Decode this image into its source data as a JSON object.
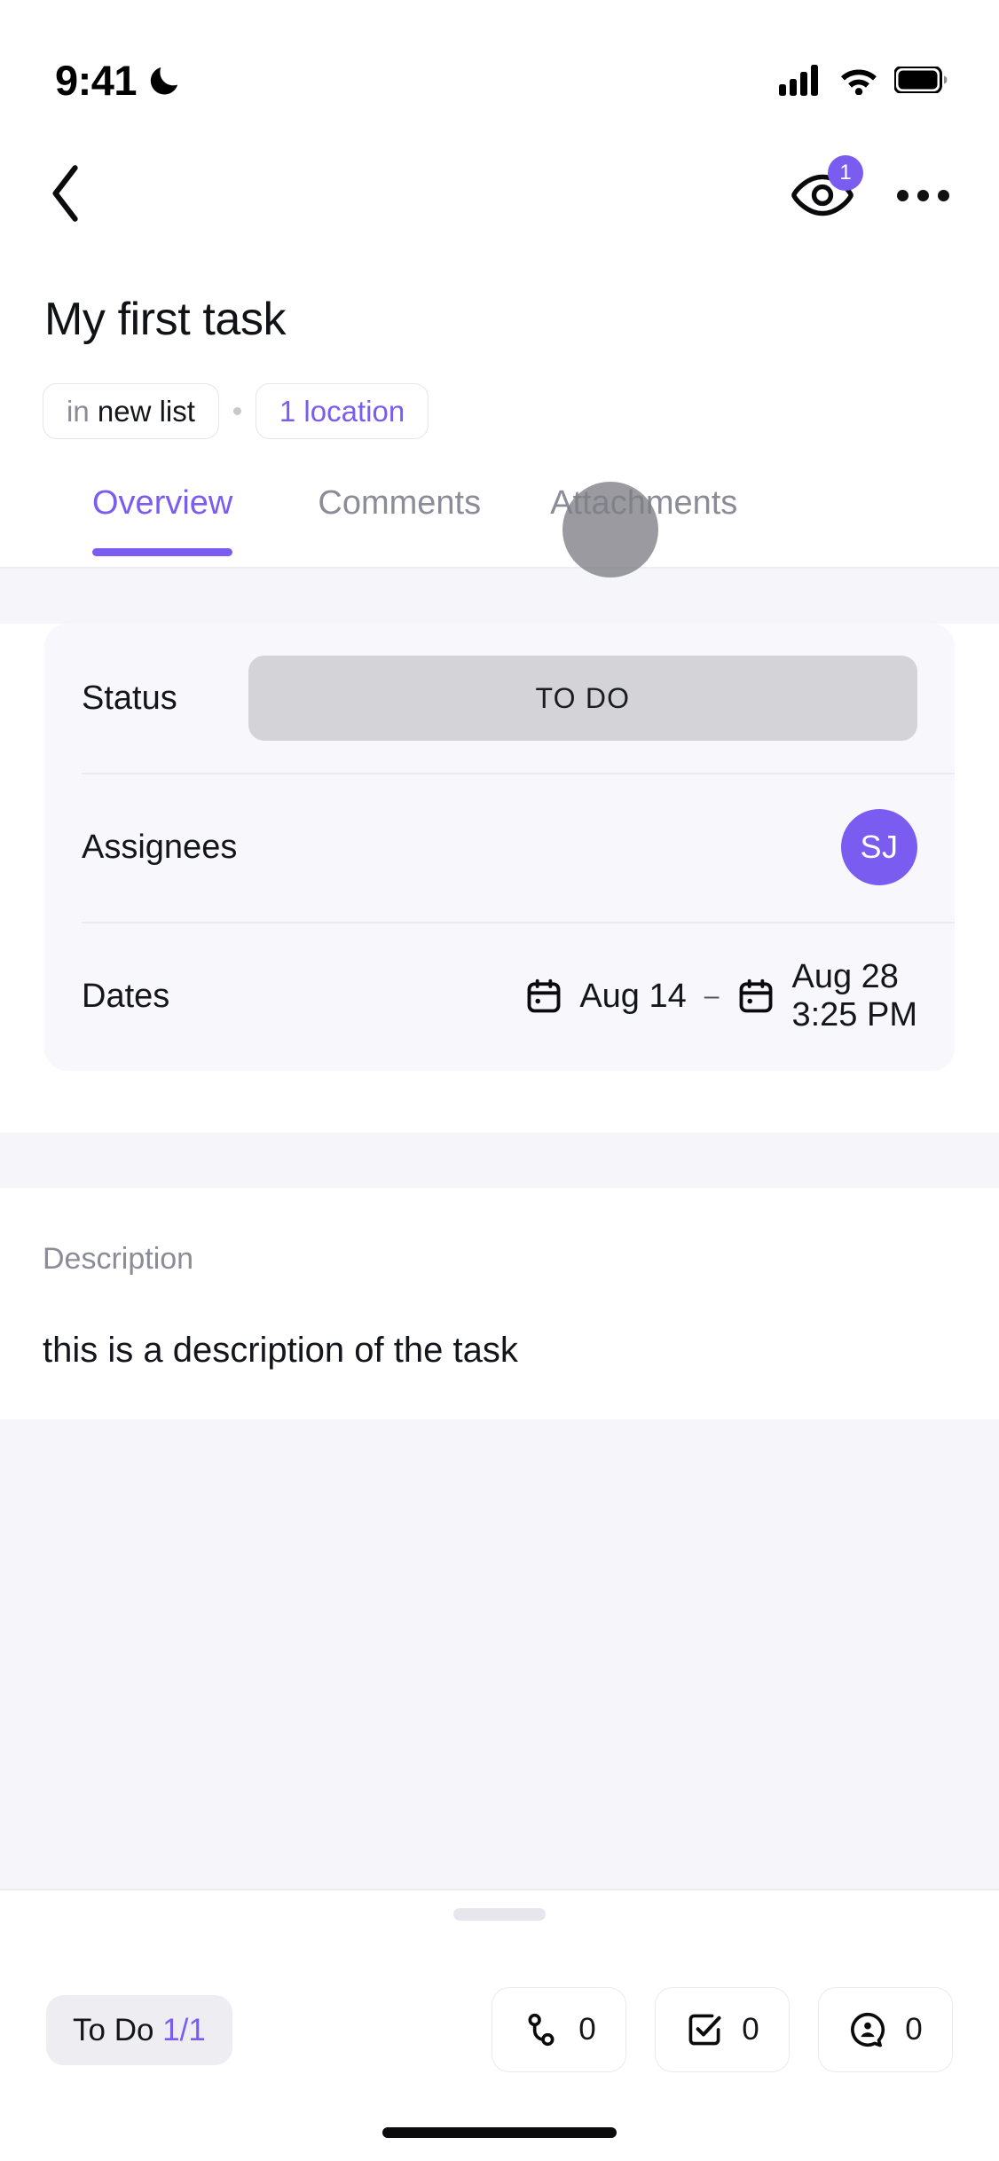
{
  "status_bar": {
    "time": "9:41",
    "dnd_icon": "moon-icon",
    "signal_icon": "cellular-signal-icon",
    "wifi_icon": "wifi-icon",
    "battery_icon": "battery-icon"
  },
  "nav": {
    "back_icon": "chevron-left-icon",
    "watchers_icon": "eye-icon",
    "watchers_count": "1",
    "more_icon": "ellipsis-icon"
  },
  "task": {
    "title": "My first task",
    "breadcrumb": {
      "list_prefix": "in",
      "list_name": "new list",
      "separator": "·",
      "locations_label": "1 location"
    }
  },
  "tabs": [
    {
      "label": "Overview",
      "active": true
    },
    {
      "label": "Comments",
      "active": false
    },
    {
      "label": "Attachments",
      "active": false
    }
  ],
  "fields": {
    "status": {
      "label": "Status",
      "value": "TO DO"
    },
    "assignees": {
      "label": "Assignees",
      "avatar_initials": "SJ"
    },
    "dates": {
      "label": "Dates",
      "start_icon": "calendar-icon",
      "start": "Aug 14",
      "separator": "–",
      "end_icon": "calendar-icon",
      "end_date": "Aug 28",
      "end_time": "3:25 PM"
    }
  },
  "description": {
    "label": "Description",
    "text": "this is a description of the task"
  },
  "bottom_bar": {
    "todo_label": "To Do",
    "todo_count": "1/1",
    "actions": [
      {
        "icon": "relationships-icon",
        "count": "0"
      },
      {
        "icon": "checklist-icon",
        "count": "0"
      },
      {
        "icon": "mention-comment-icon",
        "count": "0"
      }
    ]
  },
  "colors": {
    "accent_purple": "#7B5CF0",
    "status_chip_grey": "#D4D4D8",
    "section_grey": "#F5F5FA",
    "card_grey": "#F7F7FC"
  }
}
